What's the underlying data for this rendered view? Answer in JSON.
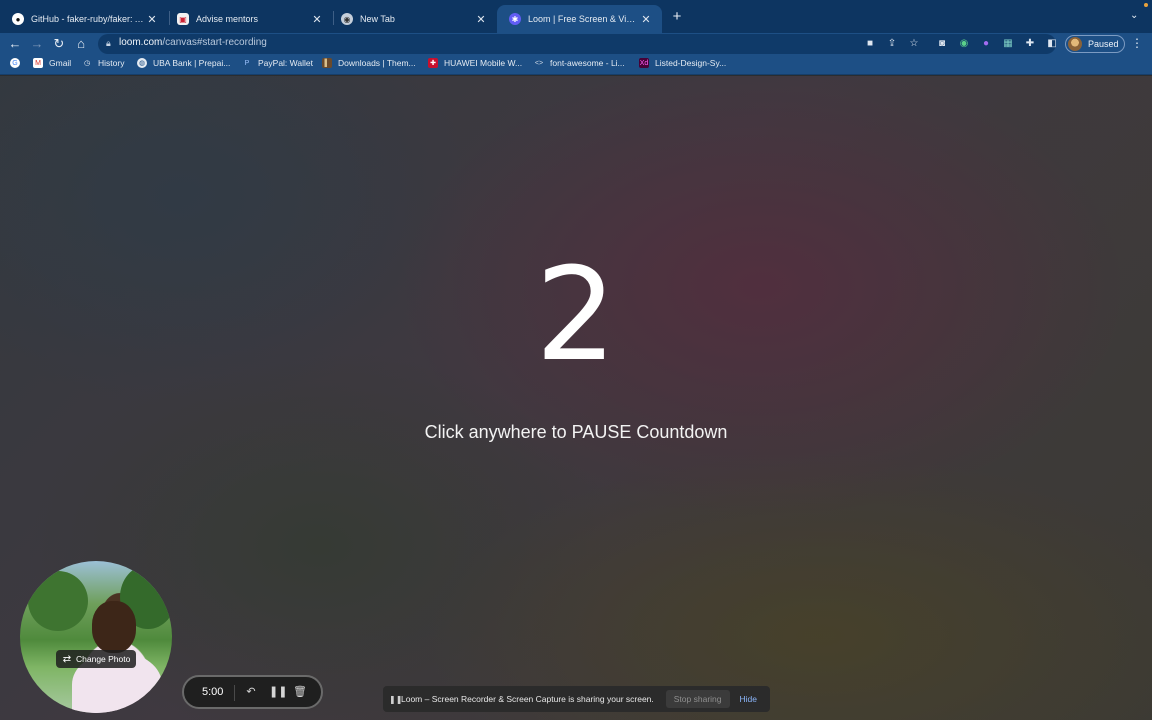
{
  "browser": {
    "tabs": [
      {
        "title": "GitHub - faker-ruby/faker: A libr",
        "icon": "github-icon",
        "active": false
      },
      {
        "title": "Advise mentors",
        "icon": "page-icon",
        "active": false
      },
      {
        "title": "New Tab",
        "icon": "chrome-icon",
        "active": false
      },
      {
        "title": "Loom | Free Screen & Video Re",
        "icon": "loom-icon",
        "active": true
      }
    ],
    "url_host": "loom.com",
    "url_path": "/canvas#start-recording",
    "profile_label": "Paused",
    "bookmarks": [
      {
        "label": "",
        "icon": "google-icon"
      },
      {
        "label": "Gmail",
        "icon": "gmail-icon"
      },
      {
        "label": "History",
        "icon": "history-icon"
      },
      {
        "label": "UBA Bank | Prepai...",
        "icon": "globe-icon"
      },
      {
        "label": "PayPal: Wallet",
        "icon": "paypal-icon"
      },
      {
        "label": "Downloads | Them...",
        "icon": "themeforest-icon"
      },
      {
        "label": "HUAWEI Mobile W...",
        "icon": "flag-icon"
      },
      {
        "label": "font-awesome - Li...",
        "icon": "code-icon"
      },
      {
        "label": "Listed-Design-Sy...",
        "icon": "xd-icon"
      }
    ]
  },
  "recording": {
    "countdown": "2",
    "hint": "Click anywhere to PAUSE Countdown",
    "change_photo": "Change Photo",
    "timer": "5:00"
  },
  "share_banner": {
    "message": "Loom – Screen Recorder & Screen Capture is sharing your screen.",
    "stop_label": "Stop sharing",
    "hide_label": "Hide"
  },
  "colors": {
    "tabstrip": "#0d3561",
    "toolbar": "#1d4f85",
    "link_blue": "#8ab4f8"
  }
}
